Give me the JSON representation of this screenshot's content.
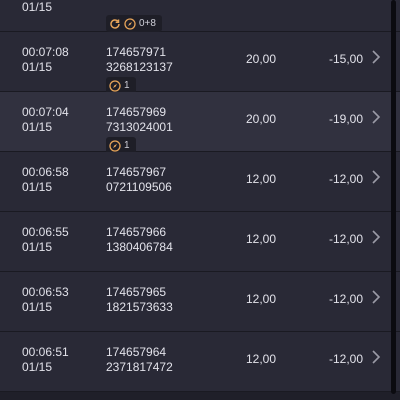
{
  "rows": [
    {
      "time": "",
      "date": "01/15",
      "id1": "",
      "id2": "",
      "badge": "0+8",
      "amount": "",
      "result": ""
    },
    {
      "time": "00:07:08",
      "date": "01/15",
      "id1": "174657971",
      "id2": "3268123137",
      "badge": "1",
      "amount": "20,00",
      "result": "-15,00"
    },
    {
      "time": "00:07:04",
      "date": "01/15",
      "id1": "174657969",
      "id2": "7313024001",
      "badge": "1",
      "amount": "20,00",
      "result": "-19,00"
    },
    {
      "time": "00:06:58",
      "date": "01/15",
      "id1": "174657967",
      "id2": "0721109506",
      "badge": "",
      "amount": "12,00",
      "result": "-12,00"
    },
    {
      "time": "00:06:55",
      "date": "01/15",
      "id1": "174657966",
      "id2": "1380406784",
      "badge": "",
      "amount": "12,00",
      "result": "-12,00"
    },
    {
      "time": "00:06:53",
      "date": "01/15",
      "id1": "174657965",
      "id2": "1821573633",
      "badge": "",
      "amount": "12,00",
      "result": "-12,00"
    },
    {
      "time": "00:06:51",
      "date": "01/15",
      "id1": "174657964",
      "id2": "2371817472",
      "badge": "",
      "amount": "12,00",
      "result": "-12,00"
    }
  ],
  "icons": {
    "refresh": "refresh-icon",
    "compass": "compass-icon",
    "chevron": "chevron-right-icon"
  },
  "colors": {
    "background": "#1f1f29",
    "row": "#292936",
    "row_highlight": "#31313f",
    "icon_accent": "#e6a45a"
  }
}
